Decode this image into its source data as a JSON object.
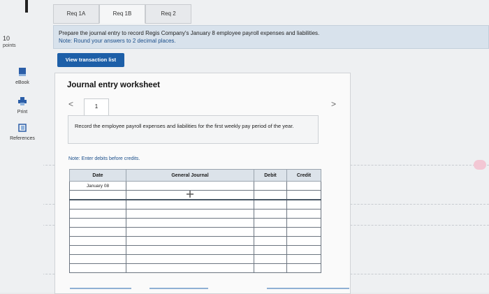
{
  "tabs": [
    {
      "label": "Req 1A",
      "active": false
    },
    {
      "label": "Req 1B",
      "active": true
    },
    {
      "label": "Req 2",
      "active": false
    }
  ],
  "rail": {
    "points_value": "10",
    "points_label": "points",
    "ebook_label": "eBook",
    "print_label": "Print",
    "references_label": "References"
  },
  "instructions": {
    "line1": "Prepare the journal entry to record Regis Company's January 8 employee payroll expenses and liabilities.",
    "line2": "Note: Round your answers to 2 decimal places."
  },
  "view_transaction_button": "View transaction list",
  "worksheet": {
    "title": "Journal entry worksheet",
    "nav_prev": "<",
    "nav_next": ">",
    "current_page": "1",
    "description": "Record the employee payroll expenses and liabilities for the first weekly pay period of the year.",
    "note": "Note: Enter debits before credits.",
    "table": {
      "headers": [
        "Date",
        "General Journal",
        "Debit",
        "Credit"
      ],
      "first_date": "January 08"
    }
  },
  "colors": {
    "accent_button": "#1d5fa8",
    "instruction_bg": "#d8e2ec",
    "note_text": "#1a4e8a"
  }
}
